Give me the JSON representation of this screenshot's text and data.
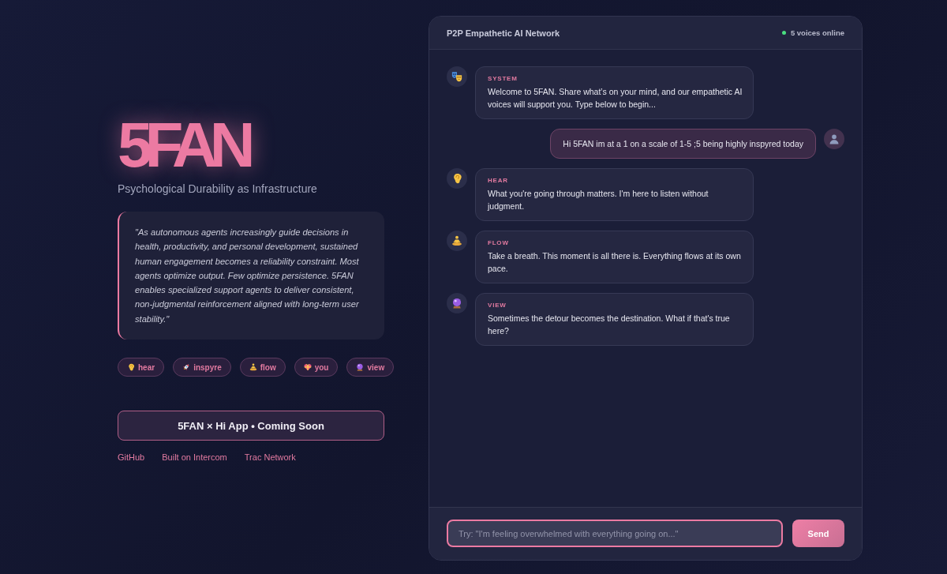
{
  "hero": {
    "title": "5FAN",
    "subtitle": "Psychological Durability as Infrastructure",
    "quote": "\"As autonomous agents increasingly guide decisions in health, productivity, and personal development, sustained human engagement becomes a reliability constraint. Most agents optimize output. Few optimize persistence. 5FAN enables specialized support agents to deliver consistent, non-judgmental reinforcement aligned with long-term user stability.\""
  },
  "voices": [
    {
      "label": "hear"
    },
    {
      "label": "inspyre"
    },
    {
      "label": "flow"
    },
    {
      "label": "you"
    },
    {
      "label": "view"
    }
  ],
  "cta": {
    "label": "5FAN × Hi App • Coming Soon"
  },
  "links": [
    "GitHub",
    "Built on Intercom",
    "Trac Network"
  ],
  "chat": {
    "title": "P2P Empathetic AI Network",
    "status": "5 voices online",
    "messages": [
      {
        "kind": "agent",
        "sender": "SYSTEM",
        "text": "Welcome to 5FAN. Share what’s on your mind, and our empathetic AI voices will support you. Type below to begin..."
      },
      {
        "kind": "user",
        "text": "Hi 5FAN im at a 1 on a scale of 1-5 ;5 being highly inspyred today"
      },
      {
        "kind": "agent",
        "sender": "HEAR",
        "text": "What you're going through matters. I'm here to listen without judgment."
      },
      {
        "kind": "agent",
        "sender": "FLOW",
        "text": "Take a breath. This moment is all there is. Everything flows at its own pace."
      },
      {
        "kind": "agent",
        "sender": "VIEW",
        "text": "Sometimes the detour becomes the destination. What if that's true here?"
      }
    ]
  },
  "composer": {
    "placeholder": "Try: \"I'm feeling overwhelmed with everything going on...\"",
    "send": "Send"
  }
}
